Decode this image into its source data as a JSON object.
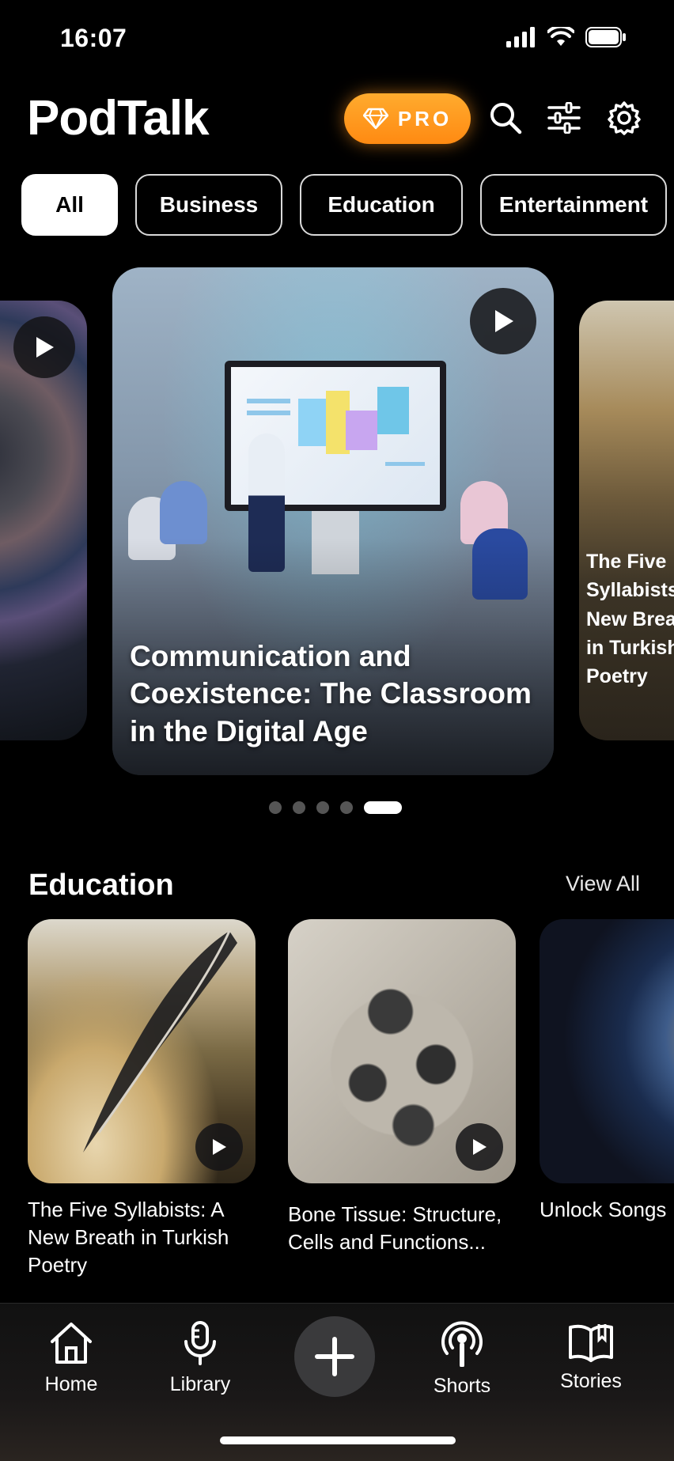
{
  "status_bar": {
    "time": "16:07"
  },
  "header": {
    "title": "PodTalk",
    "pro_label": "PRO"
  },
  "chips": [
    "All",
    "Business",
    "Education",
    "Entertainment"
  ],
  "active_chip": "All",
  "carousel": {
    "main_title": "Communication and Coexistence: The Classroom in the Digital Age",
    "right_peek_title": "The Five Syllabists New Brea in Turkish Poetry",
    "dot_count": 5,
    "active_dot": 5
  },
  "section": {
    "title": "Education",
    "view_all": "View All",
    "cards": [
      {
        "title": "The Five Syllabists: A New Breath in Turkish Poetry"
      },
      {
        "title": "Bone Tissue: Structure, Cells and Functions..."
      },
      {
        "title": "Unlock Songs"
      }
    ]
  },
  "nav": {
    "home": "Home",
    "library": "Library",
    "shorts": "Shorts",
    "stories": "Stories"
  },
  "icons": {
    "pro": "diamond-icon",
    "search": "search-icon",
    "filter": "sliders-icon",
    "settings": "gear-icon",
    "play": "play-icon",
    "home": "home-icon",
    "library": "microphone-icon",
    "add": "plus-icon",
    "shorts": "podcast-icon",
    "stories": "book-icon"
  },
  "colors": {
    "accent": "#FF9A1F",
    "background": "#000000"
  }
}
